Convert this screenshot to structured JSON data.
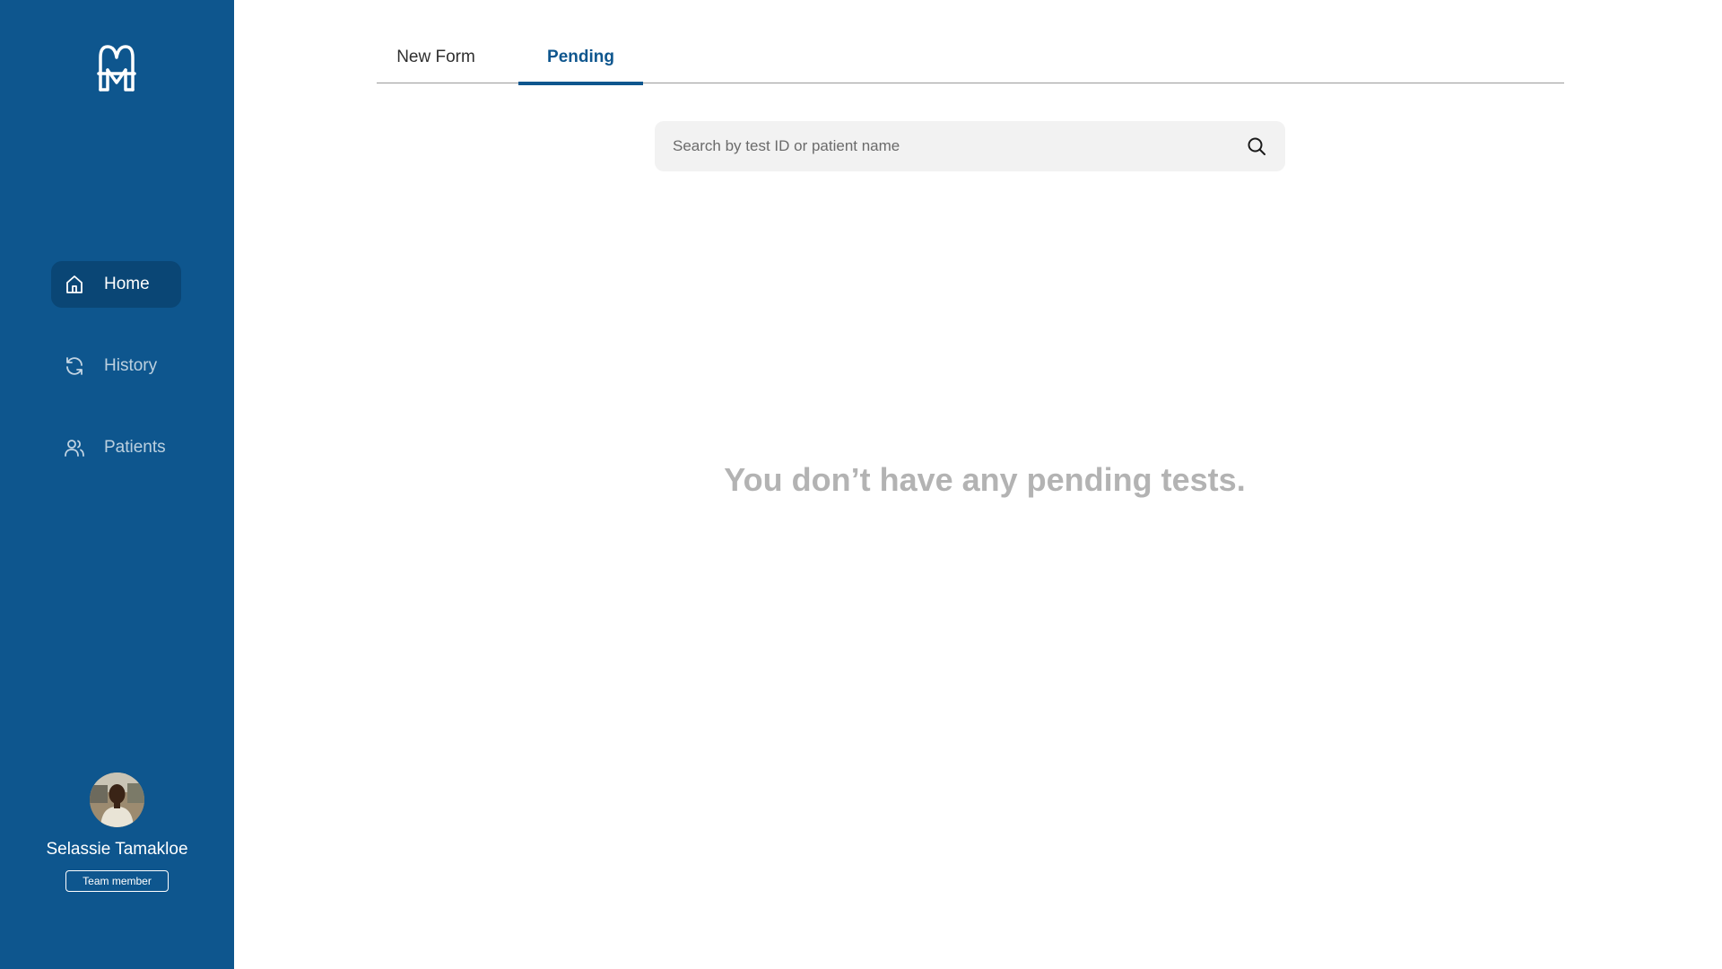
{
  "sidebar": {
    "logo_icon": "m-monogram-logo",
    "items": [
      {
        "label": "Home",
        "icon": "home-icon",
        "active": true
      },
      {
        "label": "History",
        "icon": "refresh-icon",
        "active": false
      },
      {
        "label": "Patients",
        "icon": "users-icon",
        "active": false
      }
    ],
    "user": {
      "name": "Selassie Tamakloe",
      "role": "Team member"
    }
  },
  "main": {
    "tabs": [
      {
        "label": "New Form",
        "active": false
      },
      {
        "label": "Pending",
        "active": true
      }
    ],
    "search": {
      "placeholder": "Search by test ID or patient name",
      "value": ""
    },
    "empty_message": "You don’t have any pending tests."
  },
  "colors": {
    "brand": "#0E568E",
    "active_nav_bg": "#0A4675",
    "empty_text": "#b3b3b3"
  }
}
